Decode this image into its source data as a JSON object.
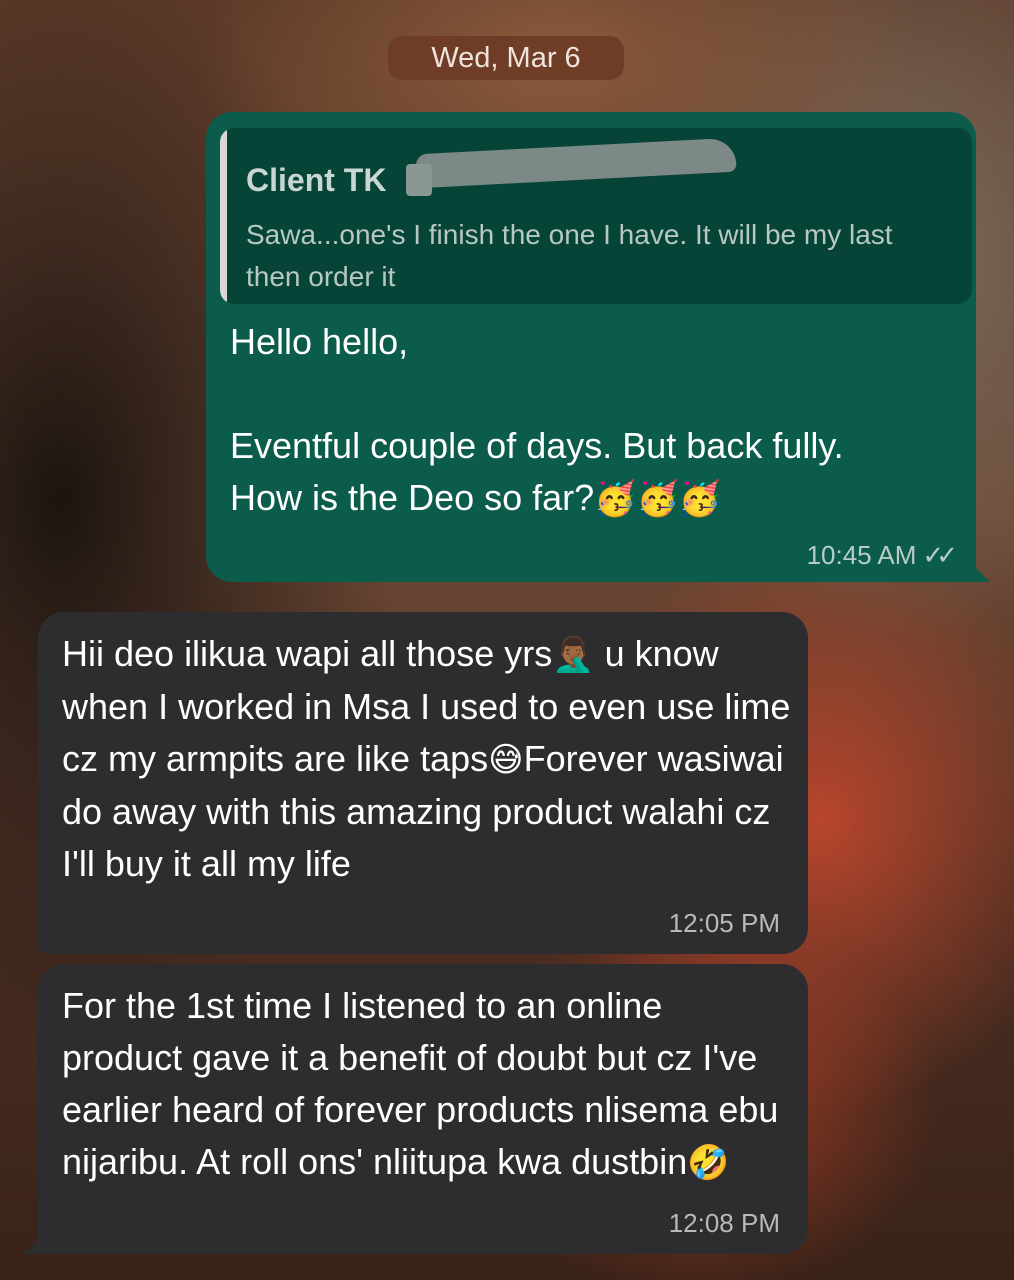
{
  "chat": {
    "date_label": "Wed, Mar 6",
    "outgoing": {
      "quote_sender": "Client TK",
      "quote_text": "Sawa...one's I finish the one I have. It will be my last then order it",
      "line1": "Hello hello,",
      "line2": "Eventful couple of days. But back fully.",
      "line3": "How is the Deo so far?",
      "emoji": "🥳🥳🥳",
      "time": "10:45 AM",
      "status_icon": "double-check-icon"
    },
    "incoming": [
      {
        "text_part1": "Hii deo ilikua wapi all those yrs",
        "emoji1": "🤦🏾‍♂️",
        "text_part2": " u know when I worked in Msa I used to even use lime cz my armpits are like taps",
        "emoji2": "😅",
        "text_part3": "Forever wasiwai do away with this amazing product walahi cz I'll buy it all my life",
        "time": "12:05 PM"
      },
      {
        "text_part1": "For the 1st time I listened to an online product gave it a benefit of doubt but cz I've earlier heard of forever products nlisema ebu nijaribu. At roll ons' nliitupa kwa dustbin",
        "emoji1": "🤣",
        "time": "12:08 PM"
      }
    ]
  },
  "colors": {
    "outgoing_bubble": "#0b5c4b",
    "incoming_bubble": "#2d2d2f",
    "quote_bg": "#064438"
  }
}
